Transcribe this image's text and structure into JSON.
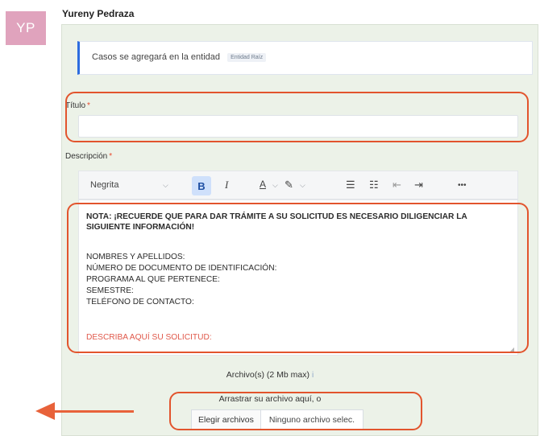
{
  "avatar": {
    "initials": "YP"
  },
  "user": {
    "name": "Yureny Pedraza"
  },
  "entity": {
    "text": "Casos se agregará en la entidad",
    "badge": "Entidad Raíz"
  },
  "title_field": {
    "label": "Título",
    "required_mark": "*",
    "value": ""
  },
  "description_field": {
    "label": "Descripción",
    "required_mark": "*"
  },
  "toolbar": {
    "style_select": "Negrita",
    "bold": "B",
    "italic": "I",
    "font_color": "A",
    "highlight": "✎",
    "bullet_list": "☰",
    "numbered_list": "☷",
    "outdent": "⇤",
    "indent": "⇥",
    "more": "•••",
    "icons": [
      "chevron-down-icon",
      "bold-icon",
      "italic-icon",
      "font-color-icon",
      "highlight-icon",
      "bullet-list-icon",
      "numbered-list-icon",
      "outdent-icon",
      "indent-icon",
      "more-icon"
    ]
  },
  "editor": {
    "note": "NOTA: ¡RECUERDE QUE PARA DAR TRÁMITE A SU SOLICITUD ES NECESARIO DILIGENCIAR LA SIGUIENTE INFORMACIÓN!",
    "fields": [
      "NOMBRES Y APELLIDOS:",
      "NÚMERO DE DOCUMENTO DE IDENTIFICACIÓN:",
      "PROGRAMA AL QUE PERTENECE:",
      "SEMESTRE:",
      "TELÉFONO DE CONTACTO:"
    ],
    "request": "DESCRIBA AQUÍ SU SOLICITUD:"
  },
  "attachments": {
    "label": "Archivo(s) (2 Mb max)",
    "info_icon": "i",
    "drag_text": "Arrastrar su archivo aquí, o",
    "choose_button": "Elegir archivos",
    "status": "Ninguno archivo selec."
  },
  "colors": {
    "avatar_bg": "#e0a3bd",
    "panel_bg": "#ecf2e8",
    "accent": "#2d6cdf",
    "annotation": "#e2542d",
    "request_text": "#e0584a"
  }
}
